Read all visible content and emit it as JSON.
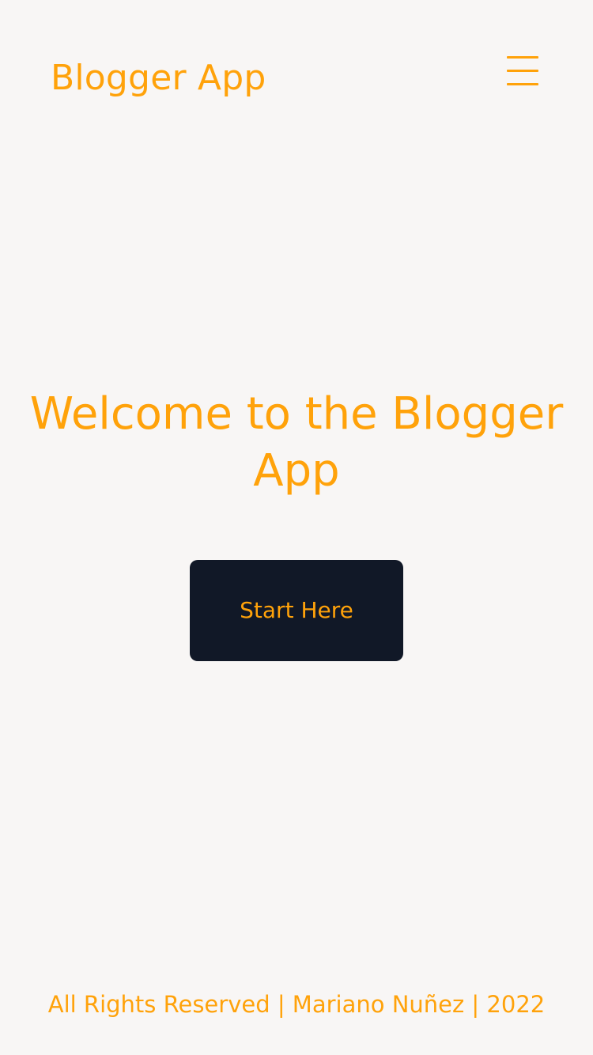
{
  "header": {
    "brand": "Blogger App",
    "menu_icon": "hamburger-menu-icon"
  },
  "hero": {
    "title": "Welcome to the Blogger App",
    "cta_label": "Start Here"
  },
  "footer": {
    "text": "All Rights Reserved | Mariano Nuñez | 2022"
  },
  "colors": {
    "background": "#f8f6f5",
    "accent": "#ffa20a",
    "button_bg": "#111827"
  }
}
